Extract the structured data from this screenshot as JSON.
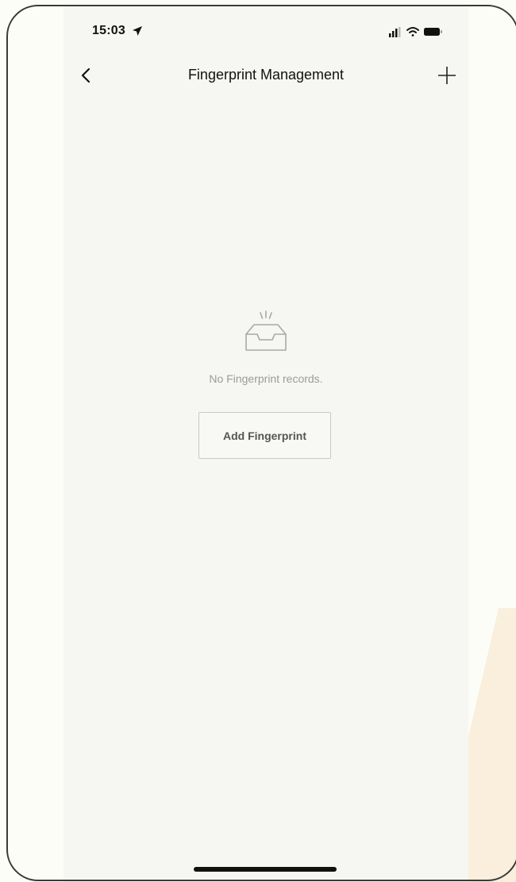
{
  "status_bar": {
    "time": "15:03",
    "icons": [
      "location-arrow-icon",
      "signal-icon",
      "wifi-icon",
      "battery-icon"
    ]
  },
  "nav": {
    "title": "Fingerprint Management",
    "back_icon": "chevron-left-icon",
    "add_icon": "plus-icon"
  },
  "empty_state": {
    "icon": "empty-inbox-icon",
    "message": "No Fingerprint records.",
    "button_label": "Add Fingerprint"
  },
  "colors": {
    "screen_background": "#f6f6f2",
    "page_background": "#fdfdf8",
    "accent_wedge": "#f9efdc",
    "text_primary": "#111111",
    "text_muted": "#9b9b9b"
  }
}
